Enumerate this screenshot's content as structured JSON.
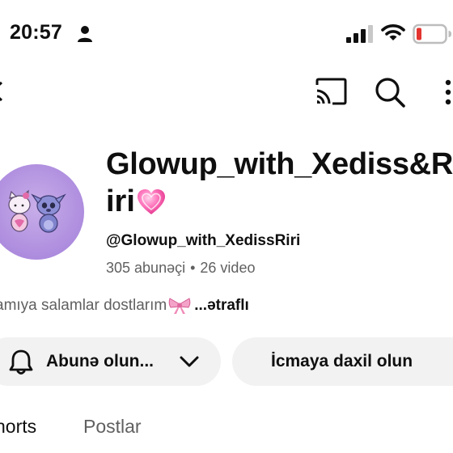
{
  "status_bar": {
    "time": "20:57",
    "icons": [
      "person-icon",
      "signal-icon",
      "wifi-icon",
      "battery-low-icon"
    ],
    "battery_color": "#e3342f"
  },
  "app_bar": {
    "icons": [
      "back-icon",
      "cast-icon",
      "search-icon",
      "more-vertical-icon"
    ]
  },
  "channel": {
    "title_line1": "Glowup_with_Xediss&Riri",
    "title_line2": "iri",
    "title_emoji": "heart-icon",
    "handle": "@Glowup_with_XedissRiri",
    "subscribers": "305 abunəçi",
    "separator": "•",
    "videos": "26 video",
    "avatar_color": "#b393e0"
  },
  "description": {
    "text": "amıya salamlar dostlarım",
    "emoji": "ribbon-bow-icon",
    "more_link": "...ətraflı"
  },
  "actions": {
    "subscribe_label": "Abunə olun...",
    "join_label": "İcmaya daxil olun"
  },
  "tabs": [
    {
      "label": "horts",
      "active": true
    },
    {
      "label": "Postlar",
      "active": false
    }
  ]
}
